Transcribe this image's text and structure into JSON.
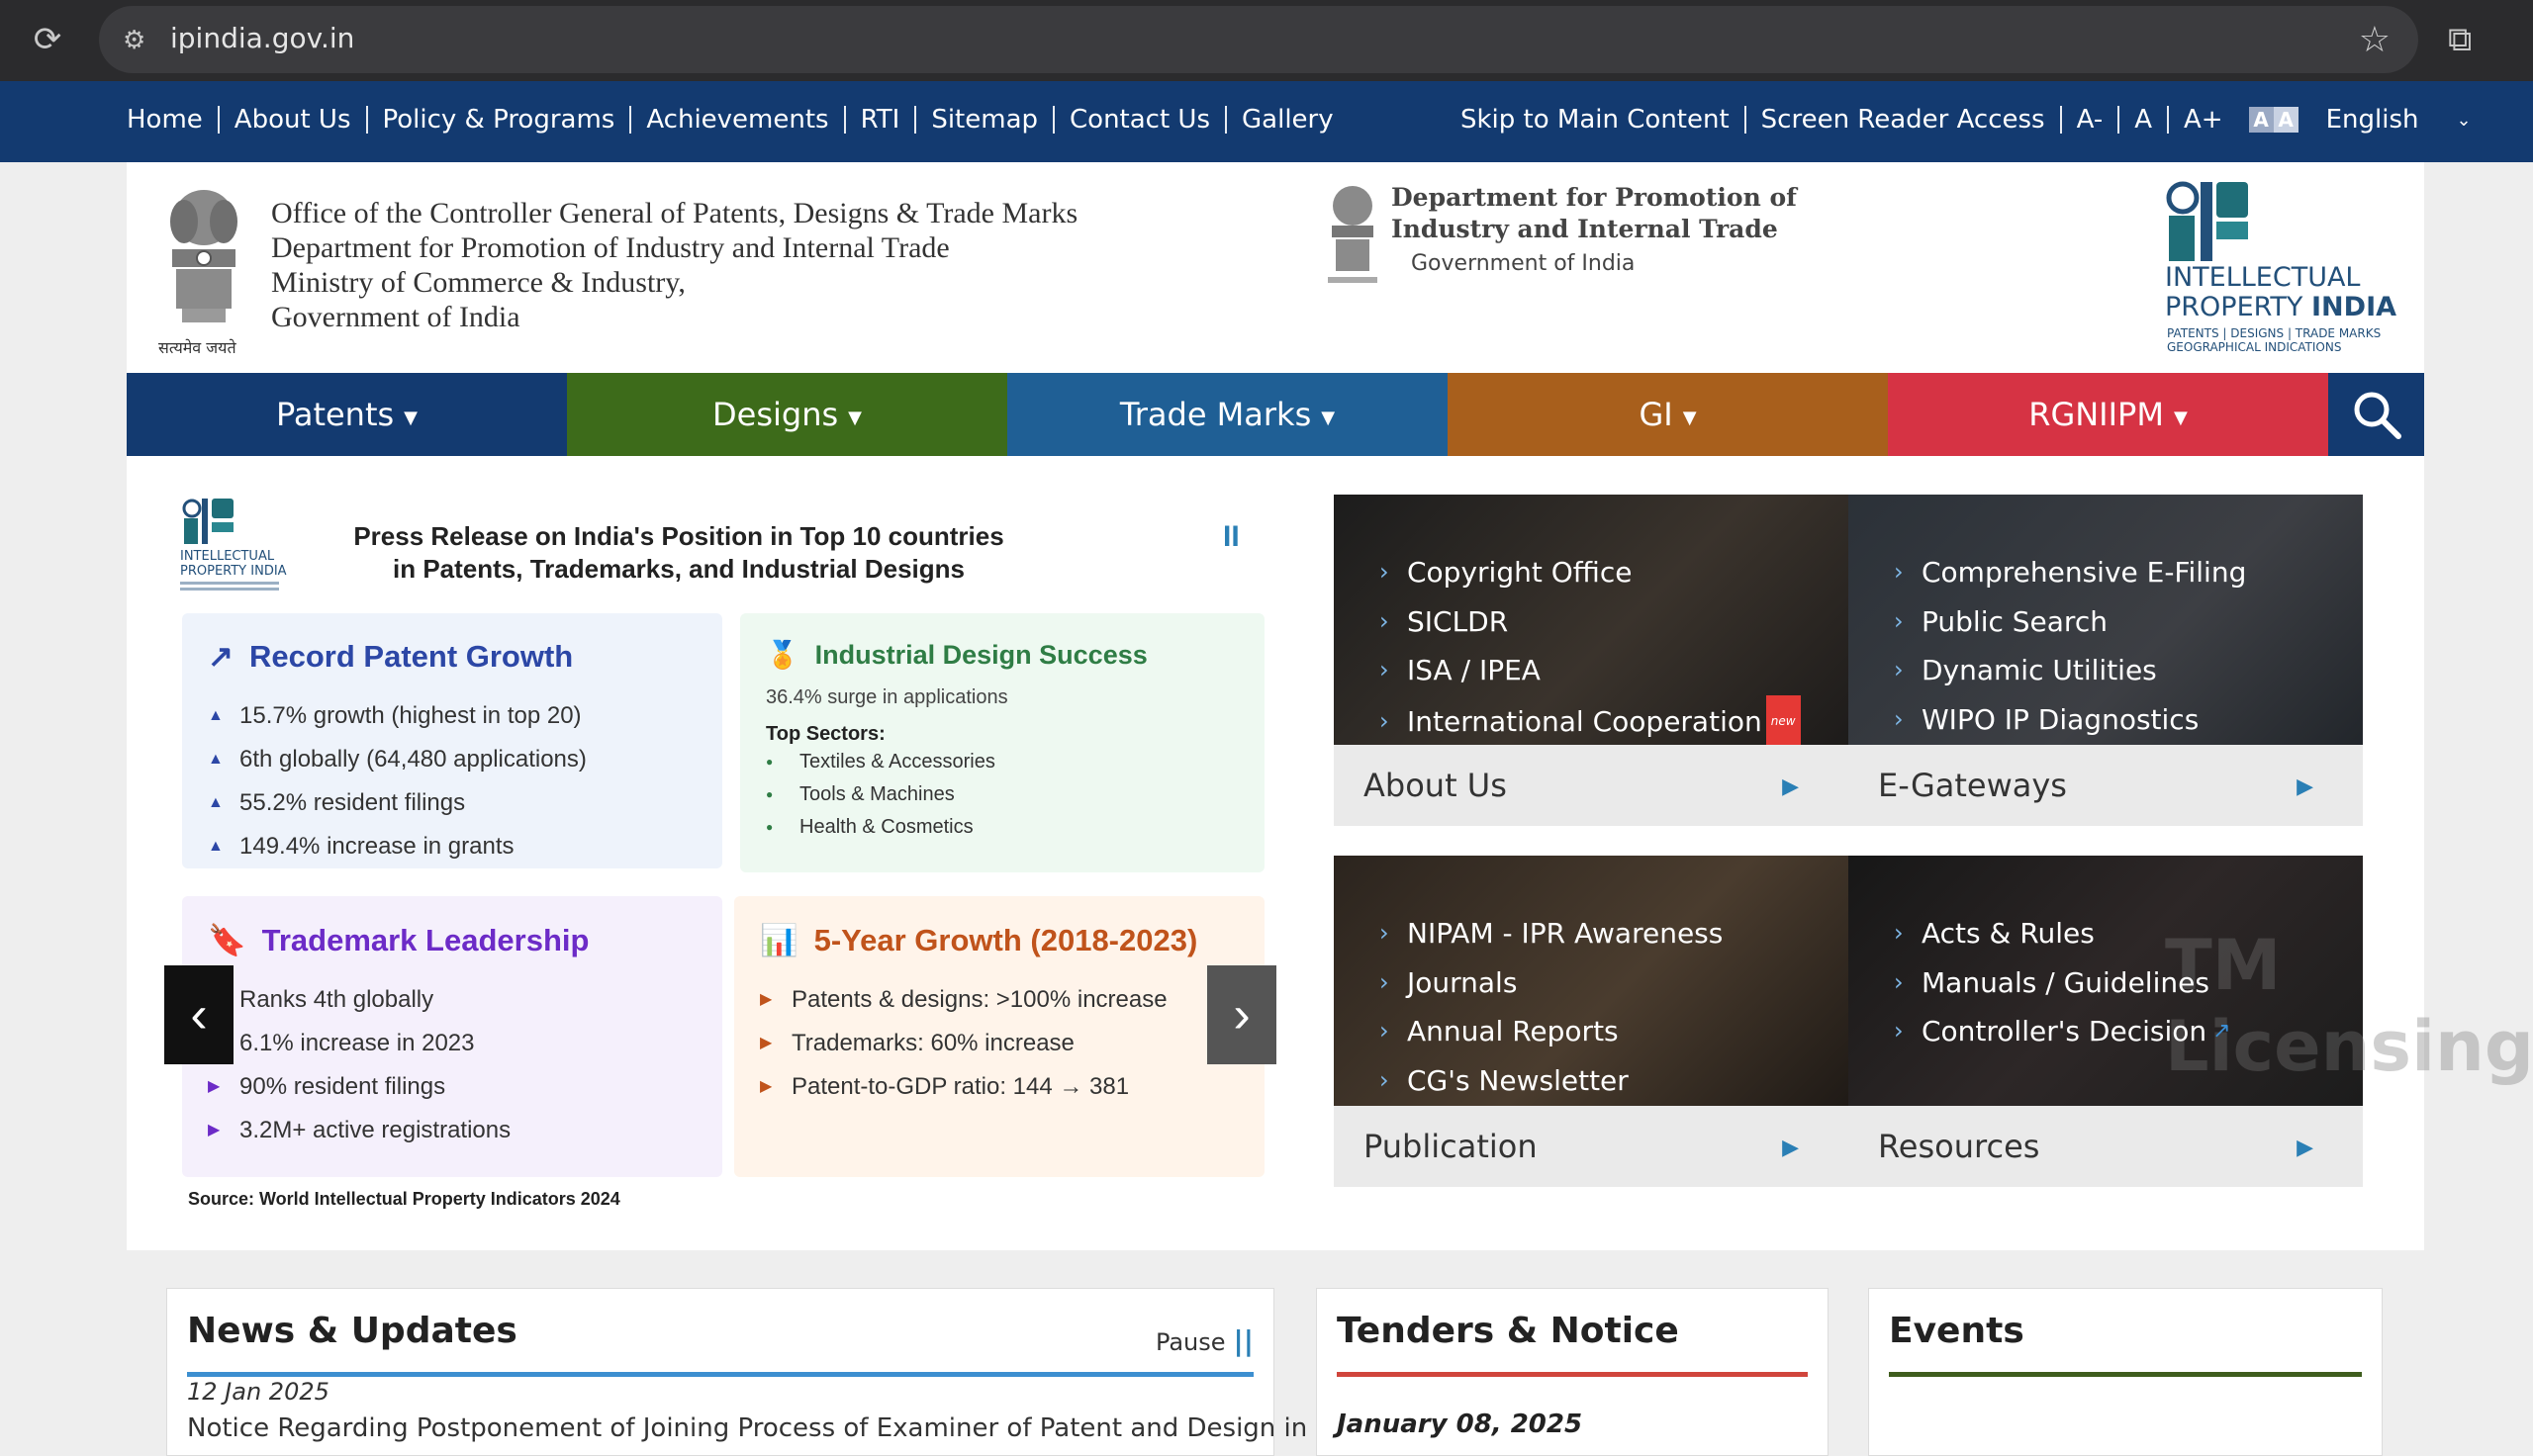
{
  "browser": {
    "url": "ipindia.gov.in"
  },
  "topnav": {
    "links": [
      "Home",
      "About Us",
      "Policy & Programs",
      "Achievements",
      "RTI",
      "Sitemap",
      "Contact Us",
      "Gallery"
    ],
    "skip": "Skip to Main Content",
    "screen_reader": "Screen Reader Access",
    "font_small": "A-",
    "font_normal": "A",
    "font_large": "A+",
    "contrast": "A",
    "language": "English"
  },
  "header": {
    "emblem_caption": "सत्यमेव जयते",
    "office_lines": [
      "Office of the Controller General of Patents, Designs & Trade Marks",
      "Department for Promotion of Industry and Internal Trade",
      "Ministry of Commerce & Industry,",
      "Government of India"
    ],
    "dpiit_line1": "Department for Promotion of",
    "dpiit_line2": "Industry and Internal Trade",
    "dpiit_gov": "Government of India",
    "ipi_line1": "INTELLECTUAL",
    "ipi_line2a": "PROPERTY",
    "ipi_line2b": "INDIA",
    "ipi_line3": "PATENTS | DESIGNS | TRADE MARKS",
    "ipi_line4": "GEOGRAPHICAL INDICATIONS"
  },
  "catnav": [
    "Patents",
    "Designs",
    "Trade Marks",
    "GI",
    "RGNIIPM"
  ],
  "slide": {
    "title_line1": "Press Release on India's Position in Top 10 countries",
    "title_line2": "in Patents, Trademarks, and Industrial Designs",
    "pause": "II",
    "card1": {
      "title": "Record Patent Growth",
      "items": [
        "15.7% growth (highest in top 20)",
        "6th globally (64,480 applications)",
        "55.2% resident filings",
        "149.4% increase in grants"
      ]
    },
    "card2": {
      "title": "Industrial Design Success",
      "sub": "36.4% surge in applications",
      "top": "Top Sectors:",
      "items": [
        "Textiles & Accessories",
        "Tools & Machines",
        "Health & Cosmetics"
      ]
    },
    "card3": {
      "title": "Trademark Leadership",
      "items": [
        "Ranks 4th globally",
        "6.1% increase in 2023",
        "90% resident filings",
        "3.2M+ active registrations"
      ]
    },
    "card4": {
      "title": "5-Year Growth (2018-2023)",
      "items": [
        "Patents & designs: >100% increase",
        "Trademarks: 60% increase",
        "Patent-to-GDP ratio: 144 → 381"
      ]
    },
    "source": "Source: World Intellectual Property Indicators 2024"
  },
  "tiles": {
    "about": {
      "items": [
        "Copyright Office",
        "SICLDR",
        "ISA / IPEA",
        "International Cooperation"
      ],
      "new": "new",
      "label": "About Us"
    },
    "egateways": {
      "items": [
        "Comprehensive E-Filing",
        "Public Search",
        "Dynamic Utilities",
        "WIPO IP Diagnostics"
      ],
      "label": "E-Gateways"
    },
    "publication": {
      "items": [
        "NIPAM - IPR Awareness",
        "Journals",
        "Annual Reports",
        "CG's Newsletter"
      ],
      "label": "Publication"
    },
    "resources": {
      "items": [
        "Acts & Rules",
        "Manuals / Guidelines",
        "Controller's Decision"
      ],
      "label": "Resources",
      "watermark": "TM Licensing"
    }
  },
  "panels": {
    "news": {
      "title": "News & Updates",
      "pause": "Pause",
      "date": "12 Jan 2025",
      "text": "Notice Regarding Postponement of Joining Process of Examiner of Patent and Design in"
    },
    "tenders": {
      "title": "Tenders & Notice",
      "date": "January 08, 2025"
    },
    "events": {
      "title": "Events"
    }
  }
}
